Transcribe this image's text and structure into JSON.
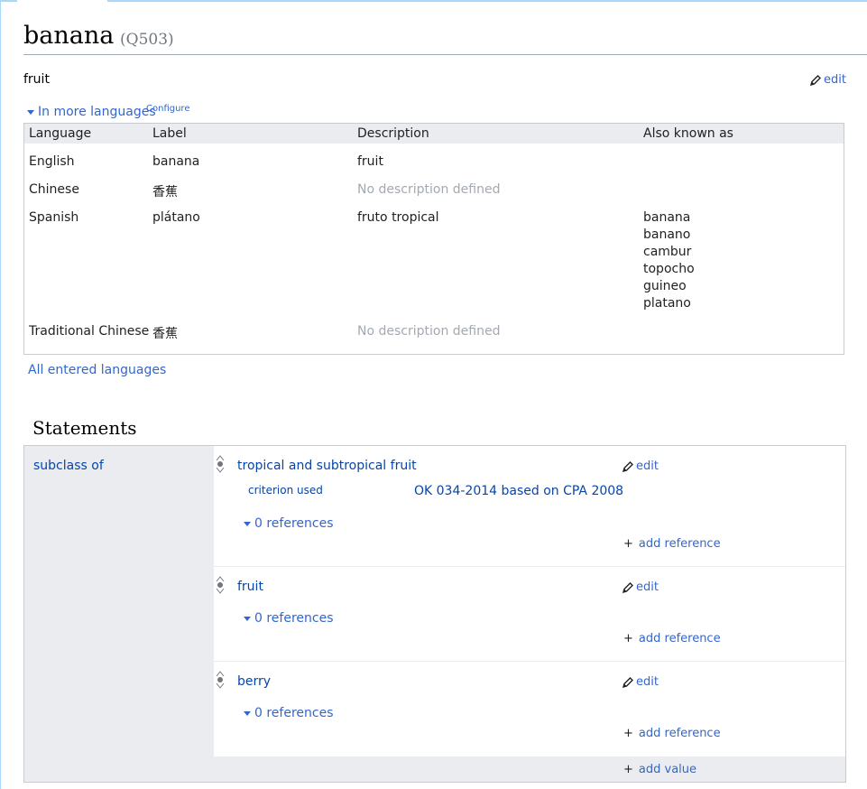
{
  "entity": {
    "label": "banana",
    "id": "(Q503)",
    "description": "fruit",
    "edit_label": "edit"
  },
  "languages": {
    "toggle_label": "In more languages",
    "configure_label": "Configure",
    "headers": [
      "Language",
      "Label",
      "Description",
      "Also known as"
    ],
    "rows": [
      {
        "language": "English",
        "label": "banana",
        "description": "fruit",
        "aliases": []
      },
      {
        "language": "Chinese",
        "label": "香蕉",
        "description": "No description defined",
        "aliases": []
      },
      {
        "language": "Spanish",
        "label": "plátano",
        "description": "fruto tropical",
        "aliases": [
          "banana",
          "banano",
          "cambur",
          "topocho",
          "guineo",
          "platano"
        ]
      },
      {
        "language": "Traditional Chinese",
        "label": "香蕉",
        "description": "No description defined",
        "aliases": []
      }
    ],
    "all_languages_link": "All entered languages"
  },
  "statements": {
    "heading": "Statements",
    "property": "subclass of",
    "claims": [
      {
        "value": "tropical and subtropical fruit",
        "qualifier_property": "criterion used",
        "qualifier_value": "OK 034-2014 based on CPA 2008",
        "references": "0 references",
        "edit": "edit",
        "add_reference": "add reference"
      },
      {
        "value": "fruit",
        "references": "0 references",
        "edit": "edit",
        "add_reference": "add reference"
      },
      {
        "value": "berry",
        "references": "0 references",
        "edit": "edit",
        "add_reference": "add reference"
      }
    ],
    "add_value": "add value"
  },
  "icons": {
    "edit": "pencil-icon",
    "toggle": "triangle-down-icon",
    "rank": "rank-normal-icon",
    "add": "plus-icon"
  },
  "colors": {
    "link": "#3366cc",
    "entity_link": "#0645ad",
    "muted": "#a2a9b1",
    "panel_bg": "#eaecf0",
    "border": "#c8ccd1"
  }
}
